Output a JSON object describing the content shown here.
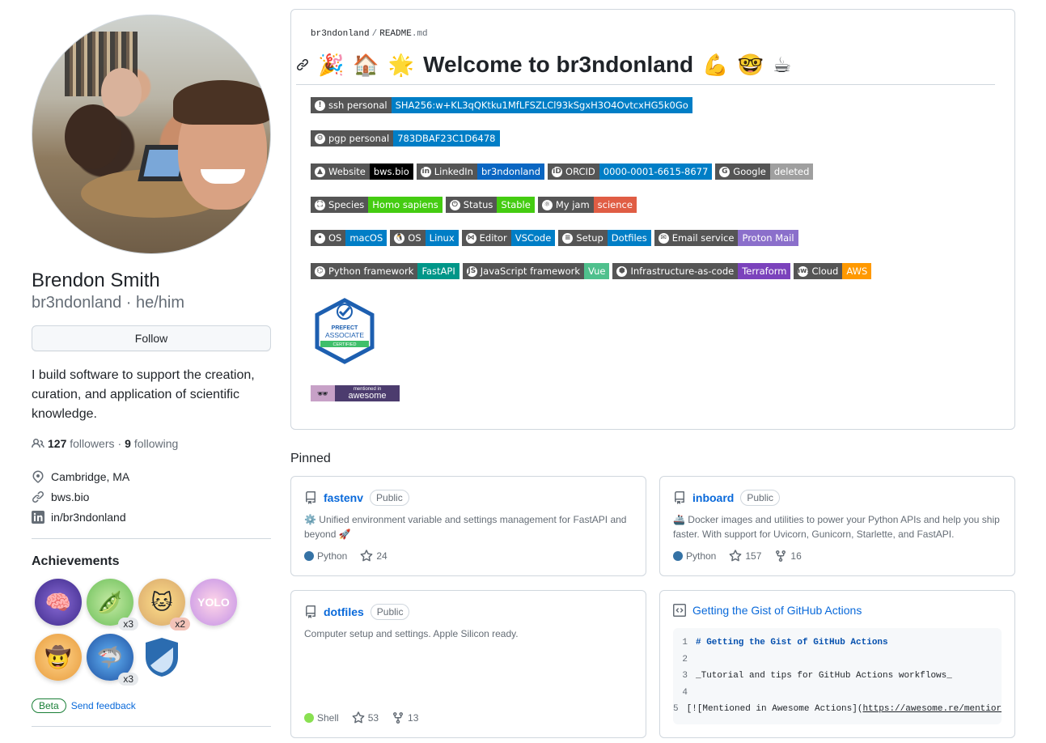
{
  "profile": {
    "fullname": "Brendon Smith",
    "nickname": "br3ndonland · he/him",
    "follow_label": "Follow",
    "bio": "I build software to support the creation, curation, and application of scientific knowledge.",
    "followers_count": "127",
    "followers_label": "followers",
    "separator": "·",
    "following_count": "9",
    "following_label": "following",
    "location": "Cambridge, MA",
    "website": "bws.bio",
    "linkedin": "in/br3ndonland"
  },
  "achievements": {
    "title": "Achievements",
    "badges": [
      {
        "name": "galaxy-brain",
        "icon": "🧠",
        "count": ""
      },
      {
        "name": "pair-extraordinaire",
        "icon": "🫛",
        "count": "x3"
      },
      {
        "name": "starstruck",
        "icon": "🐱",
        "count": "x2"
      },
      {
        "name": "yolo",
        "icon": "YOLO",
        "count": ""
      },
      {
        "name": "quickdraw",
        "icon": "🤠",
        "count": ""
      },
      {
        "name": "pull-shark",
        "icon": "🦈",
        "count": "x3"
      },
      {
        "name": "arctic-code-vault",
        "icon": "🛡",
        "count": ""
      }
    ],
    "beta_label": "Beta",
    "feedback_label": "Send feedback"
  },
  "readme": {
    "path_user": "br3ndonland",
    "path_sep": "/",
    "path_file": "README",
    "path_ext": ".md",
    "emoji_left": [
      "🎉",
      "🏠",
      "🌟"
    ],
    "heading": "Welcome to br3ndonland",
    "emoji_right": [
      "💪",
      "🤓",
      "☕"
    ],
    "shield_rows": [
      [
        {
          "label": "ssh personal",
          "value": "SHA256:w+KL3qQKtku1MfLFSZLCl93kSgxH3O4OvtcxHG5k0Go",
          "color": "#007ec6",
          "icon": "key-icon"
        }
      ],
      [
        {
          "label": "pgp personal",
          "value": "783DBAF23C1D6478",
          "color": "#007ec6",
          "icon": "gnupg-icon"
        }
      ],
      [
        {
          "label": "Website",
          "value": "bws.bio",
          "color": "#000000",
          "icon": "vercel-icon"
        },
        {
          "label": "LinkedIn",
          "value": "br3ndonland",
          "color": "#0a66c2",
          "icon": "linkedin-icon"
        },
        {
          "label": "ORCID",
          "value": "0000-0001-6615-8677",
          "color": "#007ec6",
          "icon": "orcid-icon"
        },
        {
          "label": "Google",
          "value": "deleted",
          "color": "#9f9f9f",
          "icon": "google-icon"
        }
      ],
      [
        {
          "label": "Species",
          "value": "Homo sapiens",
          "color": "#4c1",
          "icon": "species-icon"
        },
        {
          "label": "Status",
          "value": "Stable",
          "color": "#4c1",
          "icon": "power-icon"
        },
        {
          "label": "My jam",
          "value": "science",
          "color": "#e05d44",
          "icon": "atom-icon"
        }
      ],
      [
        {
          "label": "OS",
          "value": "macOS",
          "color": "#007ec6",
          "icon": "apple-icon"
        },
        {
          "label": "OS",
          "value": "Linux",
          "color": "#007ec6",
          "icon": "linux-icon"
        },
        {
          "label": "Editor",
          "value": "VSCode",
          "color": "#007ec6",
          "icon": "vscode-icon"
        },
        {
          "label": "Setup",
          "value": "Dotfiles",
          "color": "#007ec6",
          "icon": "setup-icon"
        },
        {
          "label": "Email service",
          "value": "Proton Mail",
          "color": "#8b6fcb",
          "icon": "mail-icon"
        }
      ],
      [
        {
          "label": "Python framework",
          "value": "FastAPI",
          "color": "#009688",
          "icon": "python-icon"
        },
        {
          "label": "JavaScript framework",
          "value": "Vue",
          "color": "#4fc08d",
          "icon": "js-icon"
        },
        {
          "label": "Infrastructure-as-code",
          "value": "Terraform",
          "color": "#7b42bc",
          "icon": "terraform-icon"
        },
        {
          "label": "Cloud",
          "value": "AWS",
          "color": "#ff9900",
          "icon": "aws-icon"
        }
      ]
    ],
    "prefect_lines": [
      "PREFECT",
      "ASSOCIATE",
      "CERTIFIED"
    ],
    "awesome_small": "mentioned in",
    "awesome_big": "awesome"
  },
  "pinned": {
    "title": "Pinned",
    "repos": [
      {
        "name": "fastenv",
        "visibility": "Public",
        "description": "⚙️ Unified environment variable and settings management for FastAPI and beyond 🚀",
        "language": "Python",
        "lang_color": "#3572A5",
        "stars": "24",
        "forks": ""
      },
      {
        "name": "inboard",
        "visibility": "Public",
        "description": "🚢 Docker images and utilities to power your Python APIs and help you ship faster. With support for Uvicorn, Gunicorn, Starlette, and FastAPI.",
        "language": "Python",
        "lang_color": "#3572A5",
        "stars": "157",
        "forks": "16"
      },
      {
        "name": "dotfiles",
        "visibility": "Public",
        "description": "Computer setup and settings. Apple Silicon ready.",
        "language": "Shell",
        "lang_color": "#89e051",
        "stars": "53",
        "forks": "13"
      }
    ],
    "gist": {
      "title": "Getting the Gist of GitHub Actions",
      "lines": [
        {
          "n": "1",
          "text": "# Getting the Gist of GitHub Actions"
        },
        {
          "n": "2",
          "text": ""
        },
        {
          "n": "3",
          "text": "_Tutorial and tips for GitHub Actions workflows_"
        },
        {
          "n": "4",
          "text": ""
        },
        {
          "n": "5",
          "text": "[![Mentioned in Awesome Actions](",
          "url": "https://awesome.re/mentior"
        }
      ]
    }
  }
}
